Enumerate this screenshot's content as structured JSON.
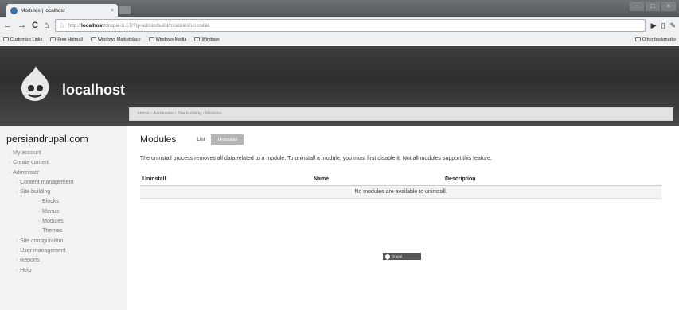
{
  "browser": {
    "tab_title": "Modules | localhost",
    "tab_close": "×",
    "url_protocol": "http://",
    "url_host": "localhost",
    "url_path": "/drupal-6.17/?q=admin/build/modules/uninstall",
    "back": "←",
    "forward": "→",
    "reload": "C",
    "home": "⌂",
    "star": "☆",
    "page_menu": "▶",
    "tools_menu": "▯",
    "wrench_menu": "✎",
    "win_min": "–",
    "win_max": "□",
    "win_close": "×"
  },
  "bookmarks": {
    "items": [
      "Customize Links",
      "Free Hotmail",
      "Windows Marketplace",
      "Windows Media",
      "Windows"
    ],
    "other": "Other bookmarks"
  },
  "site": {
    "name": "localhost",
    "sidebar_title": "persiandrupal.com"
  },
  "menu": {
    "my_account": "My account",
    "create_content": "Create content",
    "administer": "Administer",
    "content_management": "Content management",
    "site_building": "Site building",
    "blocks": "Blocks",
    "menus": "Menus",
    "modules": "Modules",
    "themes": "Themes",
    "site_configuration": "Site configuration",
    "user_management": "User management",
    "reports": "Reports",
    "help": "Help"
  },
  "breadcrumb": "Home › Administer › Site building › Modules",
  "page": {
    "title": "Modules",
    "tab_list": "List",
    "tab_uninstall": "Uninstall",
    "intro": "The uninstall process removes all data related to a module. To uninstall a module, you must first disable it. Not all modules support this feature."
  },
  "table": {
    "headers": [
      "Uninstall",
      "Name",
      "Description"
    ],
    "empty": "No modules are available to uninstall."
  },
  "footer": {
    "powered": "Drupal"
  }
}
